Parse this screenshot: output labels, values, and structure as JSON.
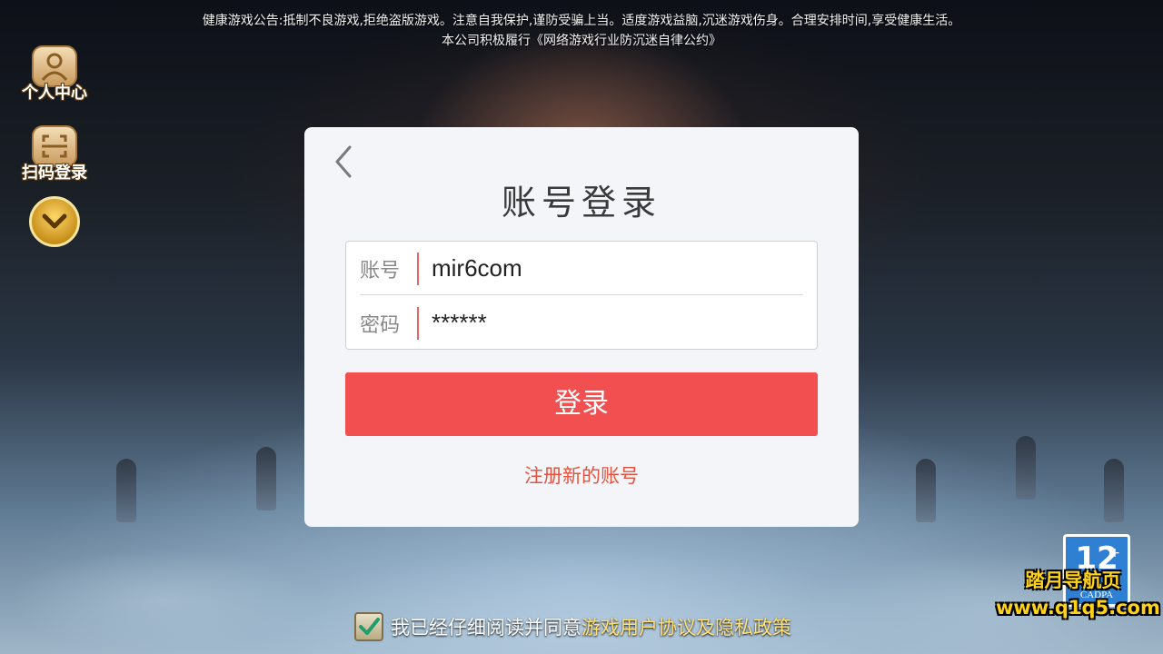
{
  "notice": {
    "line1": "健康游戏公告:抵制不良游戏,拒绝盗版游戏。注意自我保护,谨防受骗上当。适度游戏益脑,沉迷游戏伤身。合理安排时间,享受健康生活。",
    "line2": "本公司积极履行《网络游戏行业防沉迷自律公约》"
  },
  "sidebar": {
    "items": [
      {
        "label": "个人中心",
        "icon": "user-icon"
      },
      {
        "label": "扫码登录",
        "icon": "qr-scan-icon"
      }
    ],
    "expand_icon": "chevron-down-icon"
  },
  "dialog": {
    "title": "账号登录",
    "back_icon": "chevron-left-icon",
    "account": {
      "label": "账号",
      "value": "mir6com"
    },
    "password": {
      "label": "密码",
      "value": "******"
    },
    "login_label": "登录",
    "register_label": "注册新的账号"
  },
  "agreement": {
    "checked": true,
    "text": "我已经仔细阅读并同意",
    "link": "游戏用户协议及隐私政策"
  },
  "age_rating": {
    "number": "12",
    "plus": "+",
    "org": "CADPA"
  },
  "watermark": {
    "line1": "踏月导航页",
    "line2": "www.q1q5.com"
  },
  "colors": {
    "accent": "#f25050",
    "link": "#e5533f",
    "agree_link": "#ffe07a",
    "badge": "#2f7fd3"
  }
}
